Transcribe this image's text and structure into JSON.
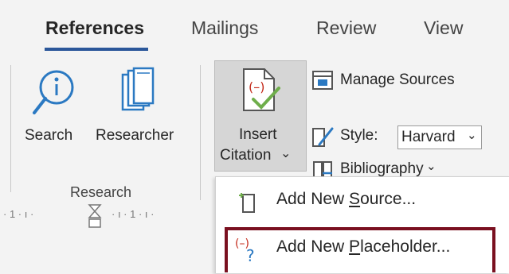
{
  "tabs": [
    {
      "label": "References",
      "active": true
    },
    {
      "label": "Mailings",
      "active": false
    },
    {
      "label": "Review",
      "active": false
    },
    {
      "label": "View",
      "active": false
    }
  ],
  "research_group": {
    "search_label": "Search",
    "researcher_label": "Researcher",
    "group_label": "Research"
  },
  "citations_group": {
    "insert_citation_line1": "Insert",
    "insert_citation_line2": "Citation",
    "insert_citation_caret": "⌄",
    "manage_sources_label": "Manage Sources",
    "style_label": "Style:",
    "style_value": "Harvard",
    "style_caret": "⌄",
    "bibliography_label": "Bibliography",
    "bibliography_caret": "⌄"
  },
  "ruler": {
    "text_left": "· 1 · ı ·",
    "text_mid": "· ı · 1 · ı ·"
  },
  "dropdown": {
    "items": [
      {
        "label_prefix": "Add New ",
        "label_accel": "S",
        "label_suffix": "ource...",
        "icon": "add-source-icon"
      },
      {
        "label_prefix": "Add New ",
        "label_accel": "P",
        "label_suffix": "laceholder...",
        "icon": "placeholder-icon"
      }
    ]
  },
  "colors": {
    "accent": "#2b579a",
    "highlight": "#7a1020",
    "citation_red": "#c42b1c",
    "check_green": "#6fae4b"
  }
}
